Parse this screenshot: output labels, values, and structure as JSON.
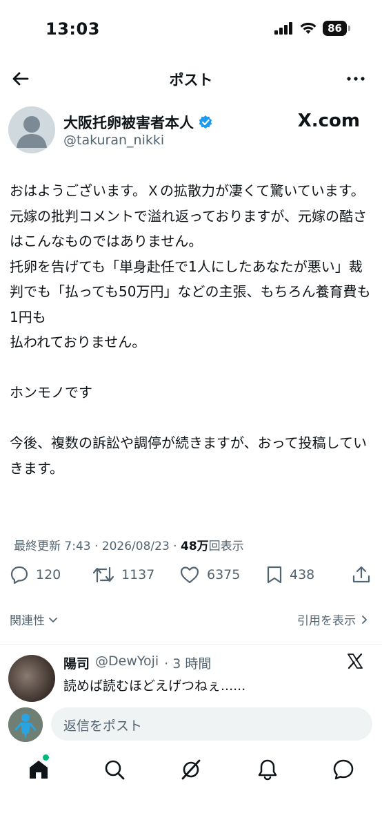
{
  "status_bar": {
    "time": "13:03",
    "battery": "86"
  },
  "nav": {
    "title": "ポスト"
  },
  "author": {
    "name": "大阪托卵被害者本人",
    "handle": "@takuran_nikki",
    "source_logo": "X.com"
  },
  "tweet": {
    "text": "おはようございます。Ｘの拡散力が凄くて驚いています。\n元嫁の批判コメントで溢れ返っておりますが、元嫁の酷さはこんなものではありません。\n托卵を告げても「単身赴任で1人にしたあなたが悪い」裁判でも「払っても50万円」などの主張、もちろん養育費も1円も\n払われておりません。\n\nホンモノです\n\n今後、複数の訴訟や調停が続きますが、おって投稿していきます。",
    "meta_prefix": "最終更新 7:43 · 2026/08/23 · ",
    "views_count": "48万",
    "views_label": "回表示"
  },
  "actions": {
    "replies": "120",
    "reposts": "1137",
    "likes": "6375",
    "bookmarks": "438"
  },
  "sort": {
    "relevance_label": "関連性",
    "quotes_label": "引用を表示"
  },
  "reply": {
    "name": "陽司",
    "handle": "@DewYoji",
    "time": "· 3 時間",
    "text": "読めば読むほどえげつねぇ......"
  },
  "compose": {
    "placeholder": "返信をポスト"
  },
  "icons": {
    "back": "arrow-left-icon",
    "more": "more-dots-icon",
    "verified": "verified-badge-icon",
    "reply": "reply-icon",
    "repost": "repost-icon",
    "like": "heart-icon",
    "bookmark": "bookmark-icon",
    "share": "share-icon",
    "home": "home-icon",
    "search": "search-icon",
    "grok": "grok-icon",
    "notifications": "bell-icon",
    "messages": "messages-icon"
  },
  "colors": {
    "accent": "#1d9bf0",
    "text": "#0f1419",
    "secondary": "#536471",
    "online": "#00ba7c"
  }
}
